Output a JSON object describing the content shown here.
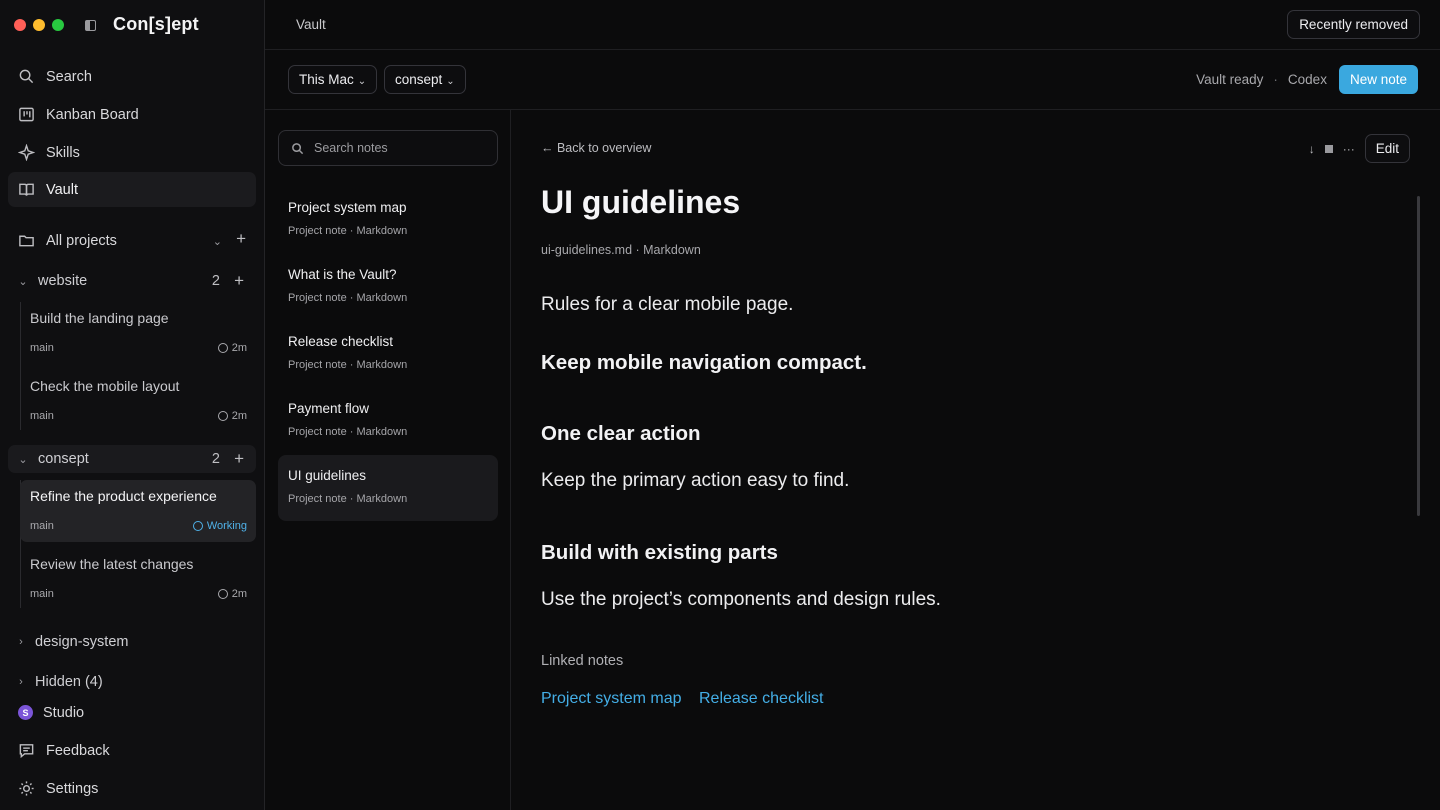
{
  "app": {
    "brand": "Con[s]ept"
  },
  "sidebar": {
    "nav": [
      {
        "label": "Search",
        "icon": "search-icon"
      },
      {
        "label": "Kanban Board",
        "icon": "kanban-icon"
      },
      {
        "label": "Skills",
        "icon": "sparkle-icon"
      },
      {
        "label": "Vault",
        "icon": "book-icon"
      }
    ],
    "all_projects": "All projects",
    "projects": [
      {
        "name": "website",
        "count": "2"
      },
      {
        "name": "consept",
        "count": "2"
      },
      {
        "name": "design-system"
      },
      {
        "name": "Hidden (4)"
      }
    ],
    "tasks_website": [
      {
        "title": "Build the landing page",
        "branch": "main",
        "status": "2m"
      },
      {
        "title": "Check the mobile layout",
        "branch": "main",
        "status": "2m"
      }
    ],
    "tasks_consept": [
      {
        "title": "Refine the product experience",
        "branch": "main",
        "status": "Working"
      },
      {
        "title": "Review the latest changes",
        "branch": "main",
        "status": "2m"
      }
    ],
    "studio": {
      "label": "Studio",
      "initial": "S"
    },
    "feedback": "Feedback",
    "settings": "Settings"
  },
  "topbar": {
    "breadcrumb": "Vault",
    "recently_removed": "Recently removed"
  },
  "toolbar": {
    "location": "This Mac",
    "project": "consept",
    "vault_status": "Vault ready",
    "separator": "·",
    "agent": "Codex",
    "new_note": "New note"
  },
  "notes": {
    "search_placeholder": "Search notes",
    "items": [
      {
        "title": "Project system map",
        "meta": "Project note · Markdown"
      },
      {
        "title": "What is the Vault?",
        "meta": "Project note · Markdown"
      },
      {
        "title": "Release checklist",
        "meta": "Project note · Markdown"
      },
      {
        "title": "Payment flow",
        "meta": "Project note · Markdown"
      },
      {
        "title": "UI guidelines",
        "meta": "Project note · Markdown"
      }
    ]
  },
  "note": {
    "back": "← Back to overview",
    "edit": "Edit",
    "title": "UI guidelines",
    "file": "ui-guidelines.md · Markdown",
    "intro": "Rules for a clear mobile page.",
    "heading1": "Keep mobile navigation compact.",
    "heading2": "One clear action",
    "para2": "Keep the primary action easy to find.",
    "heading3": "Build with existing parts",
    "para3": "Use the project’s components and design rules.",
    "linked_label": "Linked notes",
    "linked": [
      "Project system map",
      "Release checklist"
    ]
  },
  "colors": {
    "accent": "#3aa8df",
    "link": "#44aee6",
    "working": "#4fb1e8"
  }
}
